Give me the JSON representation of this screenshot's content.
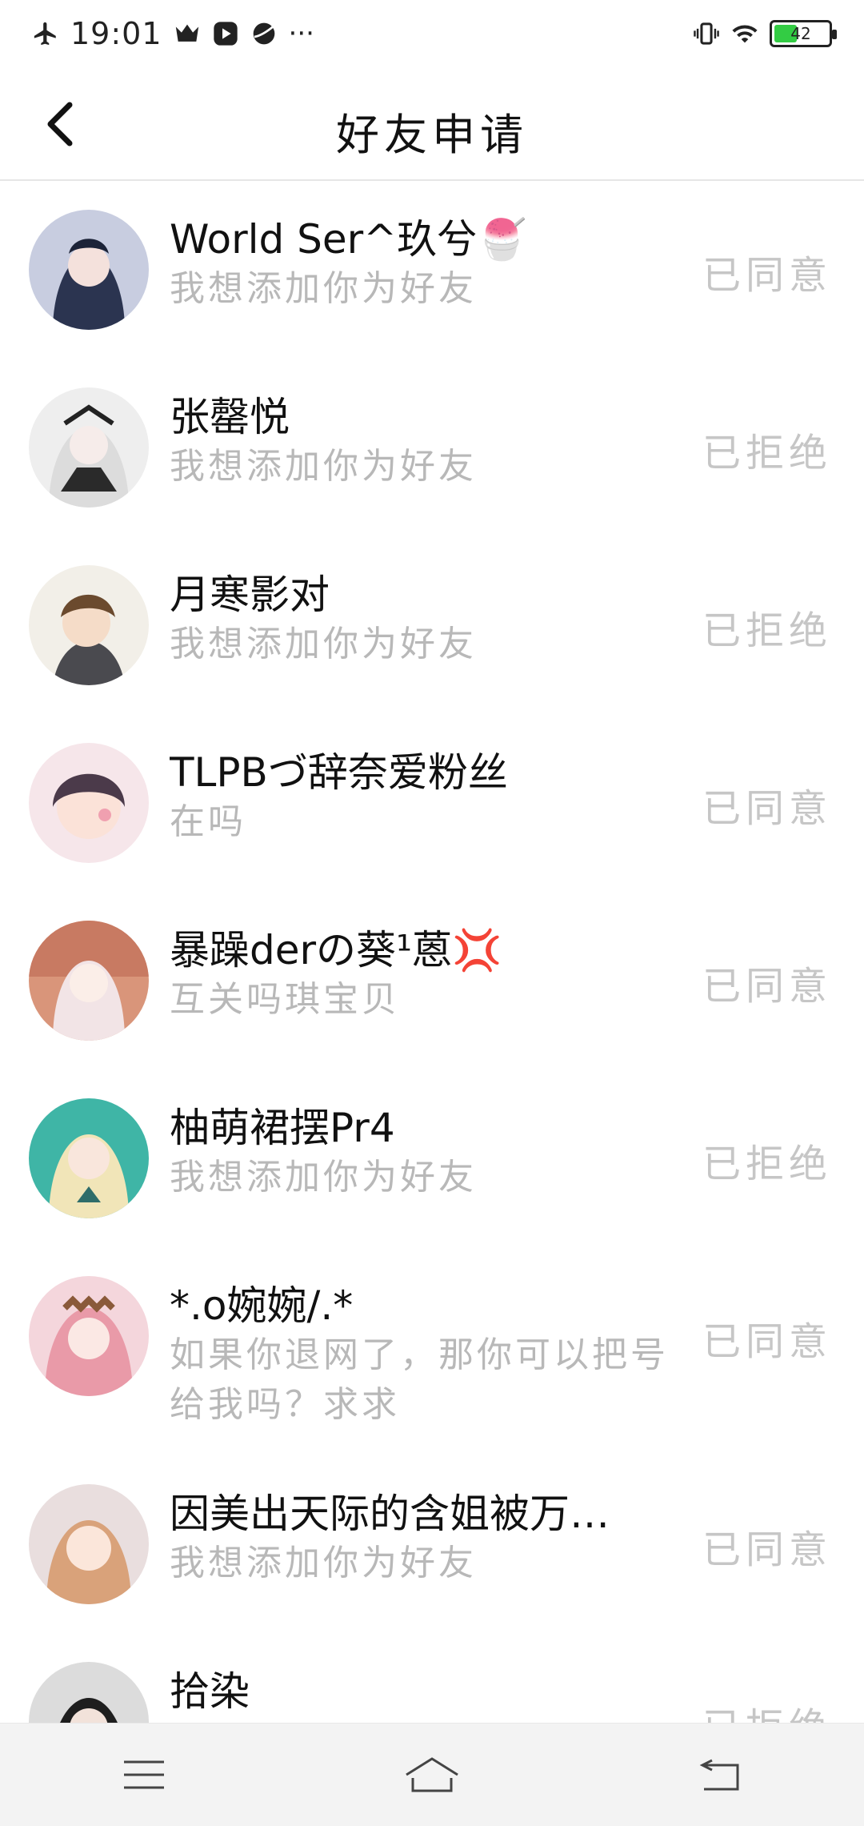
{
  "status_bar": {
    "time": "19:01",
    "more": "···",
    "battery_level": "42",
    "battery_fraction": 0.42
  },
  "header": {
    "title": "好友申请"
  },
  "requests": [
    {
      "name": "World Ser^玖兮🍧",
      "message": "我想添加你为好友",
      "status": "已同意"
    },
    {
      "name": "张罄悦",
      "message": "我想添加你为好友",
      "status": "已拒绝"
    },
    {
      "name": "月寒影对",
      "message": "我想添加你为好友",
      "status": "已拒绝"
    },
    {
      "name": "TLPBづ辞奈爱粉丝",
      "message": "在吗",
      "status": "已同意"
    },
    {
      "name": "暴躁derの葵¹蒽💢",
      "message": "互关吗琪宝贝",
      "status": "已同意"
    },
    {
      "name": "柚萌裙摆Pr4",
      "message": "我想添加你为好友",
      "status": "已拒绝"
    },
    {
      "name": "*.o婉婉/.*",
      "message": "如果你退网了，那你可以把号给我吗？求求",
      "status": "已同意"
    },
    {
      "name": "因美出天际的含姐被万…",
      "message": "我想添加你为好友",
      "status": "已同意"
    },
    {
      "name": "拾染",
      "message": "",
      "status": "已拒绝"
    }
  ],
  "icons": {
    "airplane": "airplane-icon",
    "crown": "crown-icon",
    "play": "play-icon",
    "planet": "planet-icon",
    "vibrate": "vibrate-icon",
    "wifi": "wifi-icon",
    "back": "back-chevron-icon",
    "menu": "menu-icon",
    "home": "home-icon",
    "return": "return-icon"
  },
  "colors": {
    "battery_fill": "#33cc44",
    "status_text": "#c6c6c6",
    "message_text": "#b8b8b8"
  }
}
